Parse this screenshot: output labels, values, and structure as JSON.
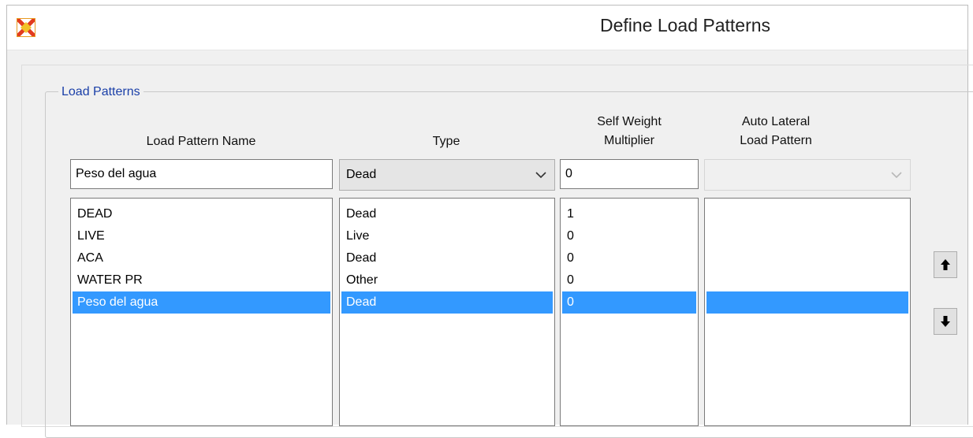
{
  "window": {
    "title": "Define Load Patterns",
    "icon": "sap2000-app-icon"
  },
  "group": {
    "label": "Load Patterns"
  },
  "columns": {
    "name": "Load Pattern Name",
    "type": "Type",
    "multiplier_line1": "Self Weight",
    "multiplier_line2": "Multiplier",
    "lateral_line1": "Auto Lateral",
    "lateral_line2": "Load Pattern"
  },
  "edit": {
    "name_value": "Peso del agua",
    "type_value": "Dead",
    "multiplier_value": "0",
    "lateral_value": ""
  },
  "lists": {
    "names": [
      "DEAD",
      "LIVE",
      "ACA",
      "WATER PR",
      "Peso del agua"
    ],
    "types": [
      "Dead",
      "Live",
      "Dead",
      "Other",
      "Dead"
    ],
    "multipliers": [
      "1",
      "0",
      "0",
      "0",
      "0"
    ],
    "laterals": [
      "",
      "",
      "",
      "",
      ""
    ],
    "selected_index": 4
  },
  "buttons": {
    "move_up_icon": "arrow-up-icon",
    "move_down_icon": "arrow-down-icon"
  },
  "colors": {
    "selection": "#3399ff",
    "group_label": "#1a3fa8"
  }
}
